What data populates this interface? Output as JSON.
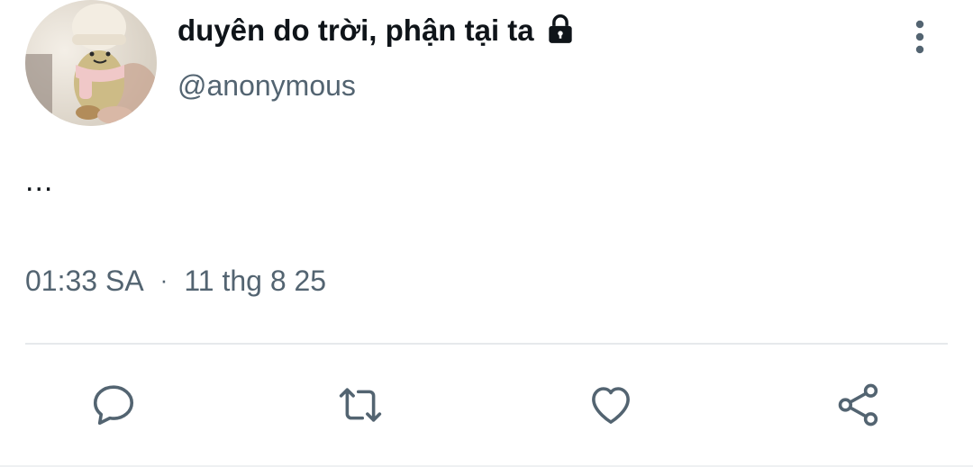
{
  "tweet": {
    "author": {
      "display_name": "duyên do trời, phận tại ta",
      "handle": "@anonymous",
      "protected_icon": "lock-icon",
      "avatar": "avatar-photo"
    },
    "text": "...",
    "time": "01:33 SA",
    "separator": "·",
    "date": "11 thg 8 25",
    "more_icon": "more-vertical-icon"
  },
  "actions": [
    {
      "name": "reply",
      "icon": "reply-icon"
    },
    {
      "name": "retweet",
      "icon": "retweet-icon"
    },
    {
      "name": "like",
      "icon": "heart-icon"
    },
    {
      "name": "share",
      "icon": "share-icon"
    }
  ],
  "colors": {
    "primary_text": "#0f1419",
    "secondary_text": "#536471",
    "icon": "#536471",
    "divider": "#e6e9ec"
  }
}
